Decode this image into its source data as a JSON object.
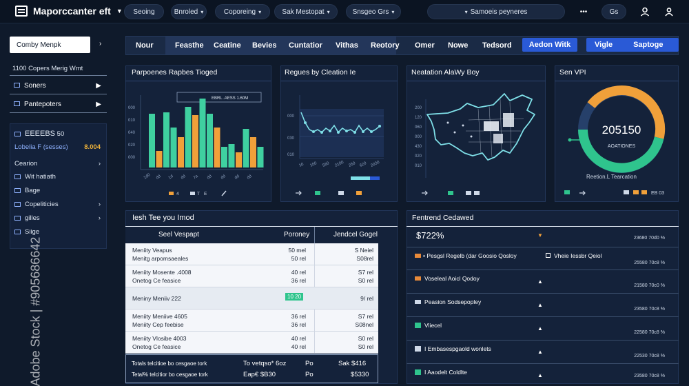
{
  "header": {
    "app_title": "Maporccanter eft",
    "nav": [
      {
        "label": "Seoing",
        "chevron": false
      },
      {
        "label": "Bnroled",
        "chevron": true
      },
      {
        "label": "Coporeing",
        "chevron": true
      },
      {
        "label": "Sak Mestopat",
        "chevron": true
      },
      {
        "label": "Snsgeo Grs",
        "chevron": true
      }
    ],
    "search_label": "Samoeis peyneres",
    "toggle_label": "Gs",
    "more_glyph": "•••"
  },
  "sidebar": {
    "company_button": "Comby Menpk",
    "title": "1100 Copers Merig Wmt",
    "items": [
      {
        "label": "Soners"
      },
      {
        "label": "Pantepoters"
      }
    ],
    "box": {
      "header": "EEEEBS",
      "header_value": "50",
      "sub_label": "Lobelia F (sesses)",
      "sub_value": "8.004",
      "rows": [
        {
          "label": "Cearion",
          "arrow": true
        },
        {
          "label": "Wit hatiath",
          "arrow": false
        },
        {
          "label": "Bage",
          "arrow": false
        },
        {
          "label": "Copeliticies",
          "arrow": true
        },
        {
          "label": "gilles",
          "arrow": true
        },
        {
          "label": "Siige",
          "arrow": false
        }
      ]
    }
  },
  "tabs": [
    "Nour",
    "Feasthe",
    "Ceatine",
    "Bevies",
    "Cuntatior",
    "Vithas",
    "Reotory",
    "Omer",
    "Nowe",
    "Tedsord",
    "Aedon Witk",
    "Vigle",
    "Saptoge"
  ],
  "cards": {
    "bar": {
      "title": "Parpoenes Rapbes Tioged",
      "legend_box": "EBRL .AESS  1.60M",
      "legend_a": "4",
      "legend_b": "T",
      "legend_c": "E"
    },
    "line": {
      "title": "Regues by Cleation Ie",
      "yticks": [
        "000",
        "030",
        "010"
      ],
      "xticks": [
        "10",
        "150",
        "580",
        "2180",
        "250",
        "620",
        "2030"
      ]
    },
    "map": {
      "title": "Neatation AlaWy Boy",
      "yticks": [
        "200",
        "120",
        "060",
        "000",
        "430",
        "020",
        "010",
        "000"
      ]
    },
    "donut": {
      "title": "Sen VPI",
      "center_value": "205150",
      "center_label": "AOATIONES",
      "caption": "Reetion.L Tearcation",
      "footer": "EB 03"
    }
  },
  "table": {
    "title": "Iesh Tee you Imod",
    "headers": [
      "Seel Vespapt",
      "Poroney",
      "Jendcel Gogel"
    ],
    "rows": [
      {
        "a1": "Meniity Veapus",
        "a2": "Menitg arpomsaeales",
        "b1": "50 mel",
        "b2": "50 rel",
        "c1": "S Neiel",
        "c2": "S08rel"
      },
      {
        "a1": "Meniity Mosente .4008",
        "a2": "Onetog Ce feasice",
        "b1": "40 rel",
        "b2": "36 rel",
        "c1": "S7 rel",
        "c2": "S0 rel"
      },
      {
        "a1": "Meniny Meniiv 222",
        "a2": "",
        "b1": "10 20",
        "b2": "",
        "c1": "9/ rel",
        "c2": ""
      },
      {
        "a1": "Meniity Meniive 4605",
        "a2": "Meniity Cep feebise",
        "b1": "36 rel",
        "b2": "36 rel",
        "c1": "S7 rel",
        "c2": "S08nel"
      },
      {
        "a1": "Meniity Vlosibe 4003",
        "a2": "Onetog Ce feasice",
        "b1": "40 rel",
        "b2": "40 rel",
        "c1": "S0 rel",
        "c2": "S0 rel"
      }
    ],
    "footer": [
      {
        "a": "Totals telcitioe bo cesgaoe tork",
        "b": "To vetqso* 6oz",
        "c": "Po",
        "d": "Sak $416"
      },
      {
        "a": "Tetal% telcitior bo cesgaoe tork",
        "b": "Eap€ $B30",
        "c": "Po",
        "d": "$5330"
      }
    ],
    "highlight": "10 20"
  },
  "feed": {
    "title": "Fentrend Cedawed",
    "headline": "$722%",
    "timestamp": "23680 70d0 %",
    "items": [
      {
        "label": "• Pesgsl Regelb (dar Goosio Qosloy",
        "extra": "Vheie Iessbr Qeiol",
        "color": "#e88a3a",
        "time": "25580 70c8 %"
      },
      {
        "label": "Voseleal Aoicl Qodoy",
        "extra": "",
        "color": "#e88a3a",
        "time": "21580 70c0 %"
      },
      {
        "label": "Peasion Sodsepopley",
        "extra": "",
        "color": "#cfd9e8",
        "time": "23580 70c8 %"
      },
      {
        "label": "Vliecel",
        "extra": "",
        "color": "#2fc48d",
        "time": "22580 70c8 %"
      },
      {
        "label": "I Embasespgaold wonlets",
        "extra": "",
        "color": "#cfd9e8",
        "time": "22530 70c8 %"
      },
      {
        "label": "I Aaodelt Coldlte",
        "extra": "",
        "color": "#2fc48d",
        "time": "23580 70c8 %"
      }
    ]
  },
  "watermark": "Adobe Stock | #905686642",
  "colors": {
    "accent": "#2a5ad6",
    "green": "#3fd0a0",
    "orange": "#f0a03a",
    "teal": "#7fe0e8"
  }
}
